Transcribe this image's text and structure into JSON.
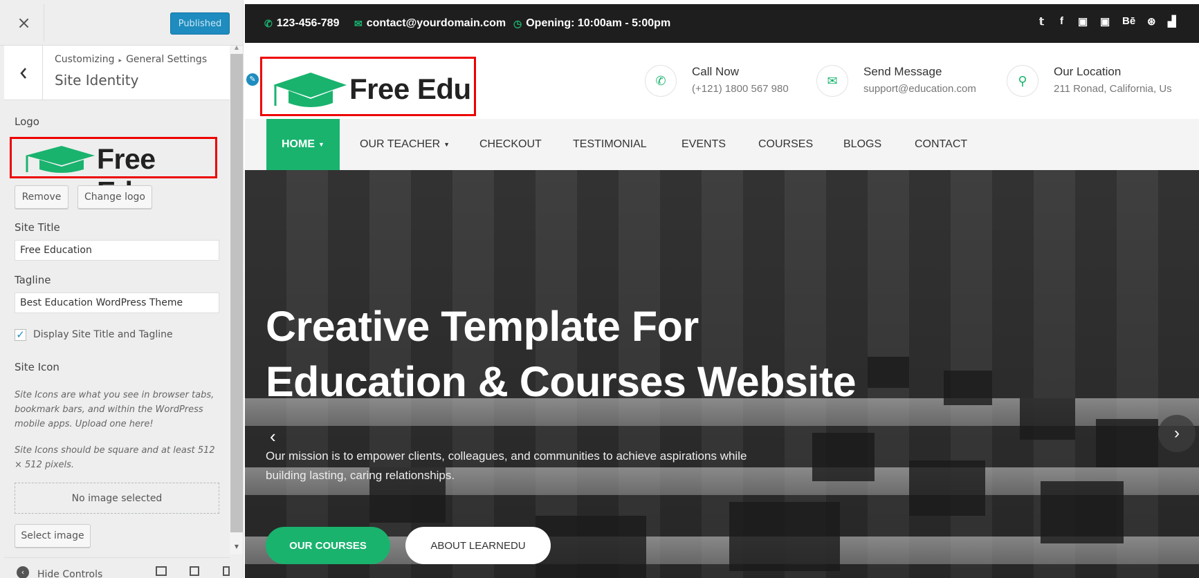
{
  "customizer": {
    "close_label": "×",
    "publish_label": "Published",
    "back_label": "‹",
    "breadcrumb_root": "Customizing",
    "breadcrumb_sep": "▸",
    "breadcrumb_parent": "General Settings",
    "section_title": "Site Identity",
    "logo_label": "Logo",
    "logo_preview_text": "Free Edu",
    "remove_button": "Remove",
    "change_logo_button": "Change logo",
    "site_title_label": "Site Title",
    "site_title_value": "Free Education",
    "tagline_label": "Tagline",
    "tagline_value": "Best Education WordPress Theme",
    "display_title_checked": true,
    "display_title_label": "Display Site Title and Tagline",
    "site_icon_label": "Site Icon",
    "site_icon_desc1": "Site Icons are what you see in browser tabs, bookmark bars, and within the WordPress mobile apps. Upload one here!",
    "site_icon_desc2": "Site Icons should be square and at least 512 × 512 pixels.",
    "no_image_text": "No image selected",
    "select_image_button": "Select image",
    "hide_controls_label": "Hide Controls",
    "accent_color": "#1e8cbe"
  },
  "site": {
    "topbar": {
      "phone": "123-456-789",
      "email": "contact@yourdomain.com",
      "opening": "Opening: 10:00am - 5:00pm",
      "social_icons": [
        "twitter-icon",
        "facebook-icon",
        "google-plus-icon",
        "linkedin-icon",
        "behance-icon",
        "dribbble-icon",
        "youtube-icon"
      ]
    },
    "logo_text": "Free Edu",
    "contacts": [
      {
        "title": "Call Now",
        "text": "(+121) 1800 567 980",
        "icon": "phone-icon"
      },
      {
        "title": "Send Message",
        "text": "support@education.com",
        "icon": "envelope-icon"
      },
      {
        "title": "Our Location",
        "text": "211 Ronad, California, Us",
        "icon": "map-marker-icon"
      }
    ],
    "nav": [
      "HOME",
      "OUR TEACHER",
      "CHECKOUT",
      "TESTIMONIAL",
      "EVENTS",
      "COURSES",
      "BLOGS",
      "CONTACT"
    ],
    "hero": {
      "title_line1": "Creative Template For",
      "title_line2": "Education & Courses Website",
      "subtitle": "Our mission is to empower clients, colleagues, and communities to achieve aspirations while building lasting, caring relationships.",
      "primary_button": "OUR COURSES",
      "secondary_button": "ABOUT LEARNEDU"
    },
    "brand_color": "#19b36e"
  }
}
